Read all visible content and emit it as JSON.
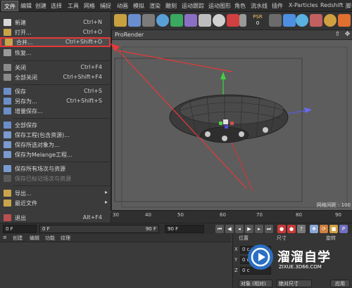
{
  "menubar": {
    "items": [
      "文件",
      "编辑",
      "创建",
      "选择",
      "工具",
      "网格",
      "捕捉",
      "动画",
      "模拟",
      "渲染",
      "雕刻",
      "运动跟踪",
      "运动图形",
      "角色",
      "流水线",
      "插件",
      "X-Particles",
      "Redshift",
      "脚"
    ]
  },
  "toolbar": {
    "psr_label": "PSR",
    "psr_value": "0"
  },
  "file_menu": {
    "items": [
      {
        "label": "新建",
        "shortcut": "Ctrl+N"
      },
      {
        "label": "打开...",
        "shortcut": "Ctrl+O"
      },
      {
        "label": "合并...",
        "shortcut": "Ctrl+Shift+O",
        "highlighted": true
      },
      {
        "label": "恢复...",
        "shortcut": ""
      },
      {
        "label": "关闭",
        "shortcut": "Ctrl+F4"
      },
      {
        "label": "全部关闭",
        "shortcut": "Ctrl+Shift+F4"
      },
      {
        "label": "保存",
        "shortcut": "Ctrl+S"
      },
      {
        "label": "另存为...",
        "shortcut": "Ctrl+Shift+S"
      },
      {
        "label": "增量保存...",
        "shortcut": ""
      },
      {
        "label": "全部保存",
        "shortcut": ""
      },
      {
        "label": "保存工程(包含资源)...",
        "shortcut": ""
      },
      {
        "label": "保存所选对象为...",
        "shortcut": ""
      },
      {
        "label": "保存为Melange工程...",
        "shortcut": ""
      },
      {
        "label": "保存所有场次与资源",
        "shortcut": ""
      },
      {
        "label": "保存已标记场次与资源",
        "shortcut": "",
        "disabled": true
      },
      {
        "label": "导出...",
        "shortcut": "",
        "submenu": true
      },
      {
        "label": "最近文件",
        "shortcut": "",
        "submenu": true
      },
      {
        "label": "退出",
        "shortcut": "Alt+F4"
      }
    ]
  },
  "viewport": {
    "tab_label": "ProRender",
    "grid_spacing": "网格间距 : 100"
  },
  "timeline": {
    "ticks": [
      "30",
      "40",
      "50",
      "60",
      "70",
      "80",
      "90"
    ],
    "start_frame": "0 F",
    "min_frame": "0 F",
    "end_frame_a": "90 F",
    "end_frame_b": "90 F"
  },
  "material_panel": {
    "tabs": [
      "创建",
      "编辑",
      "功能",
      "纹理"
    ]
  },
  "coordinates": {
    "headers": [
      "位置",
      "尺寸",
      "旋转"
    ],
    "axes": [
      "X",
      "Y",
      "Z"
    ],
    "value": "0 c",
    "mode_a": "对象 (相对)",
    "mode_b": "绝对尺寸",
    "apply": "应用"
  },
  "watermark": {
    "title": "溜溜自学",
    "url": "ZIXUE.3D66.COM"
  },
  "colors": {
    "highlight_red": "#e83838",
    "accent_blue": "#2b6fc2"
  }
}
